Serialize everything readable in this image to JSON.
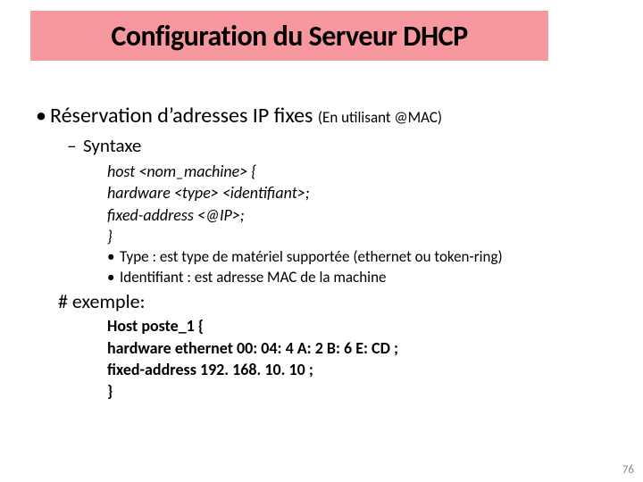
{
  "title": "Configuration du Serveur DHCP",
  "lvl1": {
    "bullet": "•",
    "text": "Réservation d’adresses IP fixes ",
    "note": "(En utilisant @MAC)"
  },
  "lvl2": {
    "dash": "–",
    "text": "Syntaxe"
  },
  "syntax": {
    "line1": "host  <nom_machine> {",
    "line2": "hardware <type> <identifiant>;",
    "line3": "fixed-address <@IP>;",
    "line4": " }"
  },
  "notes": {
    "dot": "•",
    "type": "Type : est type de matériel supportée (ethernet ou token-ring)",
    "identifiant": "Identifiant : est adresse MAC de la machine"
  },
  "example": {
    "header": "# exemple:",
    "line1": "Host   poste_1 {",
    "line2": "hardware ethernet 00: 04: 4 A: 2 B: 6 E: CD ;",
    "line3": "fixed-address 192. 168. 10. 10 ;",
    "line4": "}"
  },
  "page_number": "76"
}
